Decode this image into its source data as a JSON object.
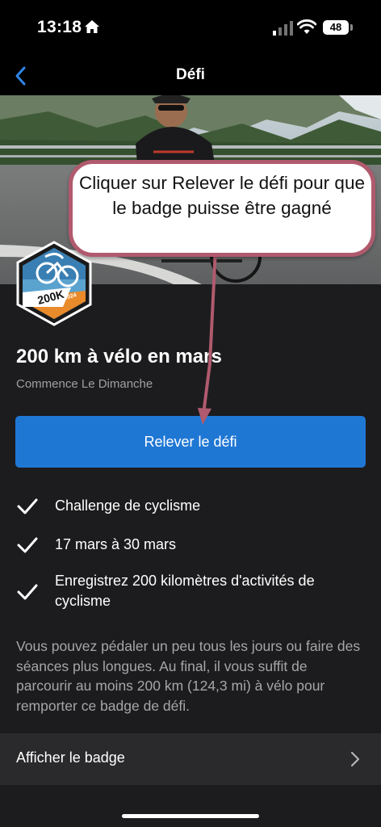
{
  "status_bar": {
    "time": "13:18",
    "battery": "48"
  },
  "nav": {
    "title": "Défi"
  },
  "challenge": {
    "title": "200 km à vélo en mars",
    "subtitle": "Commence Le Dimanche",
    "badge_text": "200K",
    "badge_year": "2024",
    "action_label": "Relever le défi",
    "details": [
      {
        "text": "Challenge de cyclisme"
      },
      {
        "text": "17 mars à 30 mars"
      },
      {
        "text": "Enregistrez 200 kilomètres d'activités de cyclisme"
      }
    ],
    "description": "Vous pouvez pédaler un peu tous les jours ou faire des séances plus longues. Au final, il vous suffit de parcourir au moins 200 km (124,3 mi) à vélo pour remporter ce badge de défi.",
    "view_badge_label": "Afficher le badge"
  },
  "annotation": {
    "callout_text": "Cliquer sur Relever le défi pour que le badge puisse être gagné"
  },
  "colors": {
    "accent": "#1f77d4",
    "callout_border": "#b05a6e",
    "background": "#1c1c1e"
  }
}
